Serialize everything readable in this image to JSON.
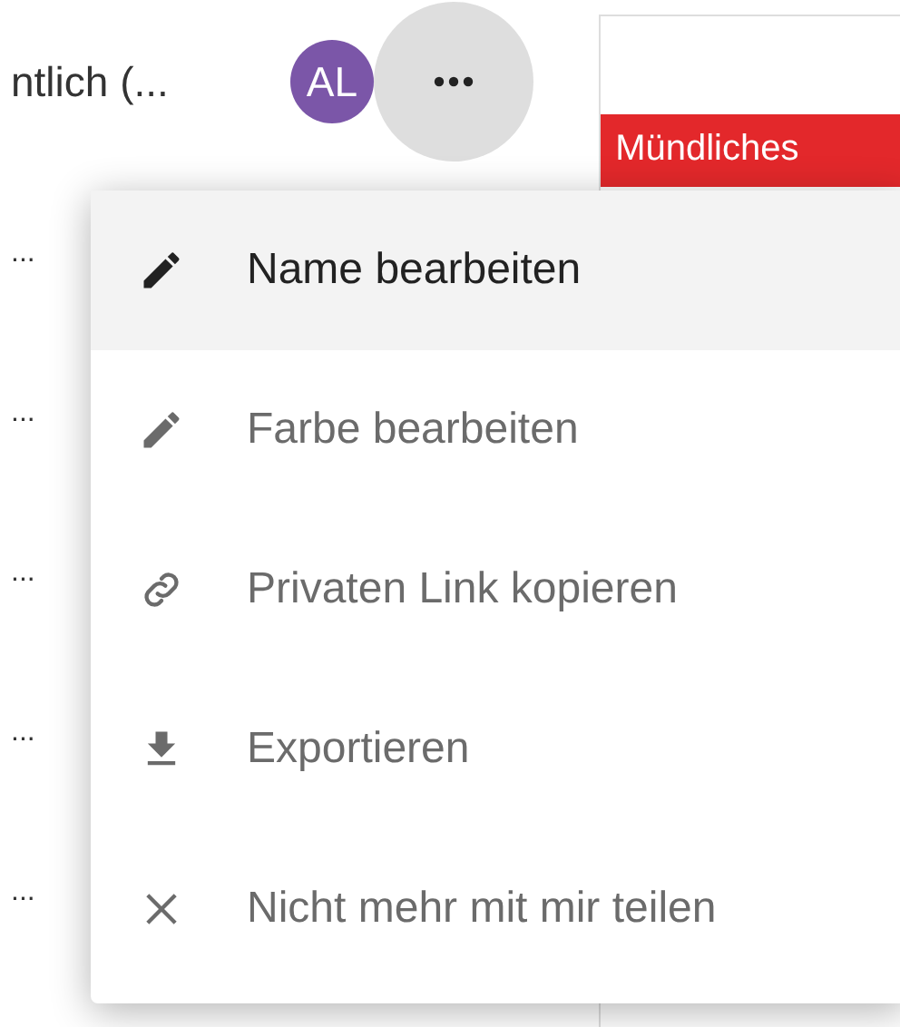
{
  "list": {
    "rows": [
      {
        "title": "ntlich (...",
        "avatar": "AL"
      },
      {
        "title": "..."
      },
      {
        "title": "..."
      },
      {
        "title": "..."
      },
      {
        "title": "..."
      },
      {
        "title": "..."
      }
    ]
  },
  "card": {
    "tag": "Mündliches"
  },
  "menu": {
    "items": [
      {
        "kind": "edit",
        "label": "Name bearbeiten",
        "selected": true
      },
      {
        "kind": "edit",
        "label": "Farbe bearbeiten",
        "selected": false
      },
      {
        "kind": "link",
        "label": "Privaten Link kopieren",
        "selected": false
      },
      {
        "kind": "download",
        "label": "Exportieren",
        "selected": false
      },
      {
        "kind": "close",
        "label": "Nicht mehr mit mir teilen",
        "selected": false
      }
    ]
  }
}
